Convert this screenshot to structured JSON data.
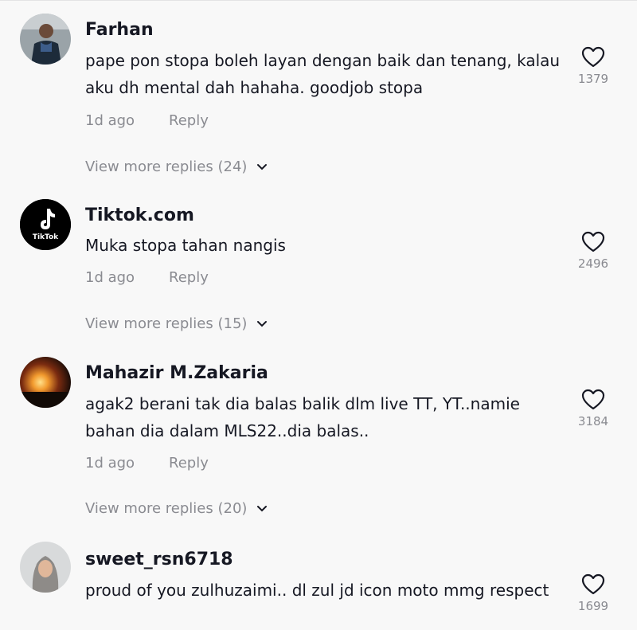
{
  "comments": [
    {
      "username": "Farhan",
      "text": "pape pon stopa boleh layan dengan baik dan tenang, kalau aku dh mental dah hahaha. goodjob stopa",
      "time": "1d ago",
      "reply_label": "Reply",
      "likes": "1379",
      "more_replies": "View more replies (24)",
      "avatar": "avatar-man-photo"
    },
    {
      "username": "Tiktok.com",
      "text": "Muka stopa tahan nangis",
      "time": "1d ago",
      "reply_label": "Reply",
      "likes": "2496",
      "more_replies": "View more replies (15)",
      "avatar": "tiktok-logo",
      "avatar_text": "TikTok"
    },
    {
      "username": "Mahazir M.Zakaria",
      "text": "agak2 berani tak dia balas balik dlm live TT, YT..namie bahan dia dalam MLS22..dia balas..",
      "time": "1d ago",
      "reply_label": "Reply",
      "likes": "3184",
      "more_replies": "View more replies (20)",
      "avatar": "sunset-photo"
    },
    {
      "username": "sweet_rsn6718",
      "text": "proud of you zulhuzaimi.. dl zul jd icon moto mmg respect",
      "likes": "1699",
      "avatar": "avatar-woman-hijab-photo"
    }
  ],
  "colors": {
    "background": "#f8f8f8",
    "text": "#161823",
    "muted": "#8a8b91"
  }
}
